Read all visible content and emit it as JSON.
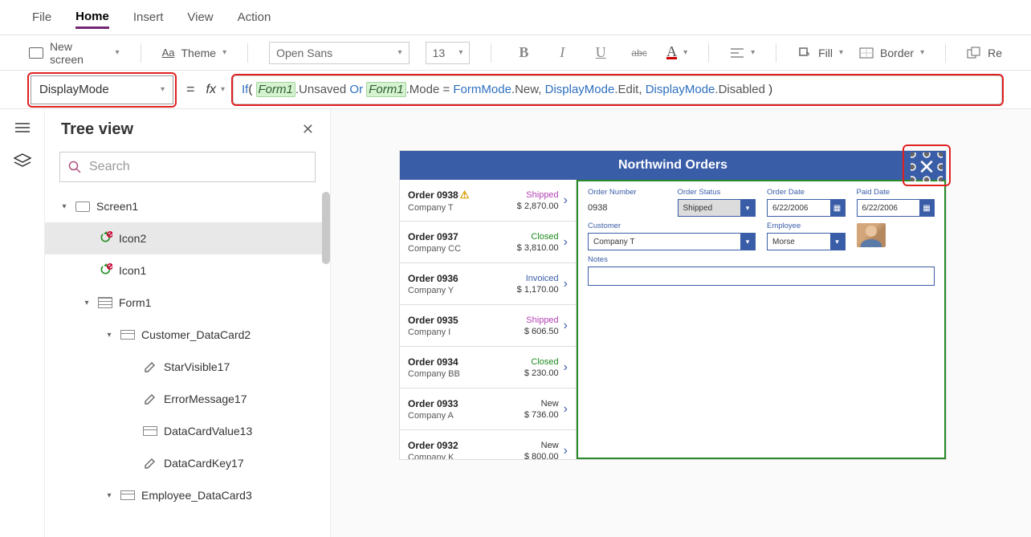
{
  "menubar": [
    "File",
    "Home",
    "Insert",
    "View",
    "Action"
  ],
  "active_menu": "Home",
  "ribbon": {
    "new_screen": "New screen",
    "theme": "Theme",
    "font": "Open Sans",
    "size": "13",
    "fill": "Fill",
    "border": "Border",
    "reorder": "Re"
  },
  "property_dropdown": "DisplayMode",
  "formula_tokens": [
    {
      "t": "fn",
      "v": "If"
    },
    {
      "t": "p",
      "v": "( "
    },
    {
      "t": "ref",
      "v": "Form1"
    },
    {
      "t": "prop",
      "v": ".Unsaved "
    },
    {
      "t": "kw",
      "v": "Or "
    },
    {
      "t": "ref",
      "v": "Form1"
    },
    {
      "t": "prop",
      "v": ".Mode = "
    },
    {
      "t": "obj",
      "v": "FormMode"
    },
    {
      "t": "prop",
      "v": ".New, "
    },
    {
      "t": "obj",
      "v": "DisplayMode"
    },
    {
      "t": "prop",
      "v": ".Edit, "
    },
    {
      "t": "obj",
      "v": "DisplayMode"
    },
    {
      "t": "prop",
      "v": ".Disabled "
    },
    {
      "t": "p",
      "v": ")"
    }
  ],
  "tree": {
    "title": "Tree view",
    "search_placeholder": "Search",
    "nodes": [
      {
        "depth": 0,
        "expand": "▾",
        "icon": "screen",
        "label": "Screen1"
      },
      {
        "depth": 1,
        "expand": "",
        "icon": "refresh",
        "label": "Icon2",
        "selected": true
      },
      {
        "depth": 1,
        "expand": "",
        "icon": "refresh",
        "label": "Icon1"
      },
      {
        "depth": 1,
        "expand": "▾",
        "icon": "form",
        "label": "Form1"
      },
      {
        "depth": 2,
        "expand": "▾",
        "icon": "card",
        "label": "Customer_DataCard2"
      },
      {
        "depth": 3,
        "expand": "",
        "icon": "pencil",
        "label": "StarVisible17"
      },
      {
        "depth": 3,
        "expand": "",
        "icon": "pencil",
        "label": "ErrorMessage17"
      },
      {
        "depth": 3,
        "expand": "",
        "icon": "card",
        "label": "DataCardValue13"
      },
      {
        "depth": 3,
        "expand": "",
        "icon": "pencil",
        "label": "DataCardKey17"
      },
      {
        "depth": 2,
        "expand": "▾",
        "icon": "card",
        "label": "Employee_DataCard3"
      }
    ]
  },
  "app": {
    "title": "Northwind Orders",
    "orders": [
      {
        "num": "Order 0938",
        "warn": true,
        "company": "Company T",
        "status": "Shipped",
        "price": "$ 2,870.00"
      },
      {
        "num": "Order 0937",
        "warn": false,
        "company": "Company CC",
        "status": "Closed",
        "price": "$ 3,810.00"
      },
      {
        "num": "Order 0936",
        "warn": false,
        "company": "Company Y",
        "status": "Invoiced",
        "price": "$ 1,170.00"
      },
      {
        "num": "Order 0935",
        "warn": false,
        "company": "Company I",
        "status": "Shipped",
        "price": "$ 606.50"
      },
      {
        "num": "Order 0934",
        "warn": false,
        "company": "Company BB",
        "status": "Closed",
        "price": "$ 230.00"
      },
      {
        "num": "Order 0933",
        "warn": false,
        "company": "Company A",
        "status": "New",
        "price": "$ 736.00"
      },
      {
        "num": "Order 0932",
        "warn": false,
        "company": "Company K",
        "status": "New",
        "price": "$ 800.00"
      }
    ],
    "form": {
      "order_number": {
        "label": "Order Number",
        "value": "0938"
      },
      "order_status": {
        "label": "Order Status",
        "value": "Shipped"
      },
      "order_date": {
        "label": "Order Date",
        "value": "6/22/2006"
      },
      "paid_date": {
        "label": "Paid Date",
        "value": "6/22/2006"
      },
      "customer": {
        "label": "Customer",
        "value": "Company T"
      },
      "employee": {
        "label": "Employee",
        "value": "Morse"
      },
      "notes": {
        "label": "Notes",
        "value": ""
      }
    }
  }
}
